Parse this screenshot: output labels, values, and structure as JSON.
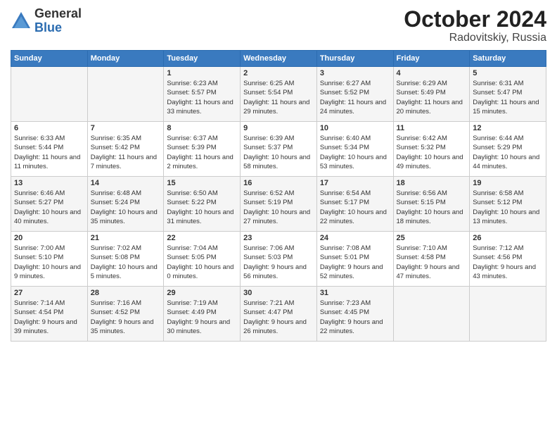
{
  "logo": {
    "general": "General",
    "blue": "Blue"
  },
  "title": "October 2024",
  "location": "Radovitskiy, Russia",
  "headers": [
    "Sunday",
    "Monday",
    "Tuesday",
    "Wednesday",
    "Thursday",
    "Friday",
    "Saturday"
  ],
  "weeks": [
    [
      {
        "day": "",
        "sunrise": "",
        "sunset": "",
        "daylight": ""
      },
      {
        "day": "",
        "sunrise": "",
        "sunset": "",
        "daylight": ""
      },
      {
        "day": "1",
        "sunrise": "Sunrise: 6:23 AM",
        "sunset": "Sunset: 5:57 PM",
        "daylight": "Daylight: 11 hours and 33 minutes."
      },
      {
        "day": "2",
        "sunrise": "Sunrise: 6:25 AM",
        "sunset": "Sunset: 5:54 PM",
        "daylight": "Daylight: 11 hours and 29 minutes."
      },
      {
        "day": "3",
        "sunrise": "Sunrise: 6:27 AM",
        "sunset": "Sunset: 5:52 PM",
        "daylight": "Daylight: 11 hours and 24 minutes."
      },
      {
        "day": "4",
        "sunrise": "Sunrise: 6:29 AM",
        "sunset": "Sunset: 5:49 PM",
        "daylight": "Daylight: 11 hours and 20 minutes."
      },
      {
        "day": "5",
        "sunrise": "Sunrise: 6:31 AM",
        "sunset": "Sunset: 5:47 PM",
        "daylight": "Daylight: 11 hours and 15 minutes."
      }
    ],
    [
      {
        "day": "6",
        "sunrise": "Sunrise: 6:33 AM",
        "sunset": "Sunset: 5:44 PM",
        "daylight": "Daylight: 11 hours and 11 minutes."
      },
      {
        "day": "7",
        "sunrise": "Sunrise: 6:35 AM",
        "sunset": "Sunset: 5:42 PM",
        "daylight": "Daylight: 11 hours and 7 minutes."
      },
      {
        "day": "8",
        "sunrise": "Sunrise: 6:37 AM",
        "sunset": "Sunset: 5:39 PM",
        "daylight": "Daylight: 11 hours and 2 minutes."
      },
      {
        "day": "9",
        "sunrise": "Sunrise: 6:39 AM",
        "sunset": "Sunset: 5:37 PM",
        "daylight": "Daylight: 10 hours and 58 minutes."
      },
      {
        "day": "10",
        "sunrise": "Sunrise: 6:40 AM",
        "sunset": "Sunset: 5:34 PM",
        "daylight": "Daylight: 10 hours and 53 minutes."
      },
      {
        "day": "11",
        "sunrise": "Sunrise: 6:42 AM",
        "sunset": "Sunset: 5:32 PM",
        "daylight": "Daylight: 10 hours and 49 minutes."
      },
      {
        "day": "12",
        "sunrise": "Sunrise: 6:44 AM",
        "sunset": "Sunset: 5:29 PM",
        "daylight": "Daylight: 10 hours and 44 minutes."
      }
    ],
    [
      {
        "day": "13",
        "sunrise": "Sunrise: 6:46 AM",
        "sunset": "Sunset: 5:27 PM",
        "daylight": "Daylight: 10 hours and 40 minutes."
      },
      {
        "day": "14",
        "sunrise": "Sunrise: 6:48 AM",
        "sunset": "Sunset: 5:24 PM",
        "daylight": "Daylight: 10 hours and 35 minutes."
      },
      {
        "day": "15",
        "sunrise": "Sunrise: 6:50 AM",
        "sunset": "Sunset: 5:22 PM",
        "daylight": "Daylight: 10 hours and 31 minutes."
      },
      {
        "day": "16",
        "sunrise": "Sunrise: 6:52 AM",
        "sunset": "Sunset: 5:19 PM",
        "daylight": "Daylight: 10 hours and 27 minutes."
      },
      {
        "day": "17",
        "sunrise": "Sunrise: 6:54 AM",
        "sunset": "Sunset: 5:17 PM",
        "daylight": "Daylight: 10 hours and 22 minutes."
      },
      {
        "day": "18",
        "sunrise": "Sunrise: 6:56 AM",
        "sunset": "Sunset: 5:15 PM",
        "daylight": "Daylight: 10 hours and 18 minutes."
      },
      {
        "day": "19",
        "sunrise": "Sunrise: 6:58 AM",
        "sunset": "Sunset: 5:12 PM",
        "daylight": "Daylight: 10 hours and 13 minutes."
      }
    ],
    [
      {
        "day": "20",
        "sunrise": "Sunrise: 7:00 AM",
        "sunset": "Sunset: 5:10 PM",
        "daylight": "Daylight: 10 hours and 9 minutes."
      },
      {
        "day": "21",
        "sunrise": "Sunrise: 7:02 AM",
        "sunset": "Sunset: 5:08 PM",
        "daylight": "Daylight: 10 hours and 5 minutes."
      },
      {
        "day": "22",
        "sunrise": "Sunrise: 7:04 AM",
        "sunset": "Sunset: 5:05 PM",
        "daylight": "Daylight: 10 hours and 0 minutes."
      },
      {
        "day": "23",
        "sunrise": "Sunrise: 7:06 AM",
        "sunset": "Sunset: 5:03 PM",
        "daylight": "Daylight: 9 hours and 56 minutes."
      },
      {
        "day": "24",
        "sunrise": "Sunrise: 7:08 AM",
        "sunset": "Sunset: 5:01 PM",
        "daylight": "Daylight: 9 hours and 52 minutes."
      },
      {
        "day": "25",
        "sunrise": "Sunrise: 7:10 AM",
        "sunset": "Sunset: 4:58 PM",
        "daylight": "Daylight: 9 hours and 47 minutes."
      },
      {
        "day": "26",
        "sunrise": "Sunrise: 7:12 AM",
        "sunset": "Sunset: 4:56 PM",
        "daylight": "Daylight: 9 hours and 43 minutes."
      }
    ],
    [
      {
        "day": "27",
        "sunrise": "Sunrise: 7:14 AM",
        "sunset": "Sunset: 4:54 PM",
        "daylight": "Daylight: 9 hours and 39 minutes."
      },
      {
        "day": "28",
        "sunrise": "Sunrise: 7:16 AM",
        "sunset": "Sunset: 4:52 PM",
        "daylight": "Daylight: 9 hours and 35 minutes."
      },
      {
        "day": "29",
        "sunrise": "Sunrise: 7:19 AM",
        "sunset": "Sunset: 4:49 PM",
        "daylight": "Daylight: 9 hours and 30 minutes."
      },
      {
        "day": "30",
        "sunrise": "Sunrise: 7:21 AM",
        "sunset": "Sunset: 4:47 PM",
        "daylight": "Daylight: 9 hours and 26 minutes."
      },
      {
        "day": "31",
        "sunrise": "Sunrise: 7:23 AM",
        "sunset": "Sunset: 4:45 PM",
        "daylight": "Daylight: 9 hours and 22 minutes."
      },
      {
        "day": "",
        "sunrise": "",
        "sunset": "",
        "daylight": ""
      },
      {
        "day": "",
        "sunrise": "",
        "sunset": "",
        "daylight": ""
      }
    ]
  ]
}
